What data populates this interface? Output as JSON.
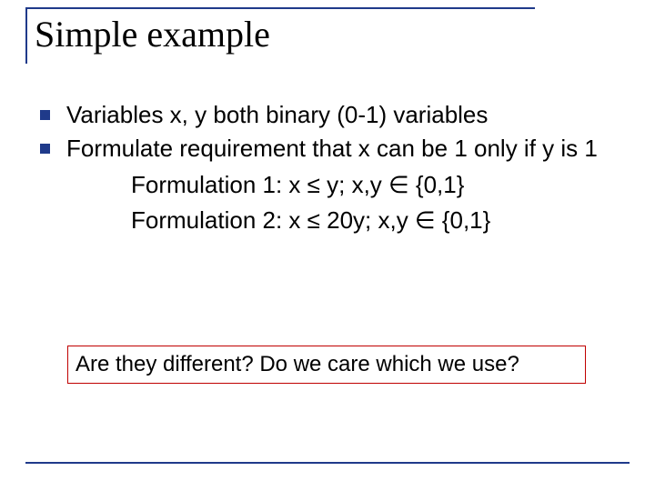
{
  "title": "Simple example",
  "bullets": [
    {
      "text": "Variables x, y both binary (0-1) variables"
    },
    {
      "text": "Formulate requirement that x can be 1 only if y is 1"
    }
  ],
  "sub": [
    "Formulation 1:  x ≤ y; x,y ∈ {0,1}",
    "Formulation 2: x ≤ 20y; x,y ∈ {0,1}"
  ],
  "callout": "Are they different?  Do we care which we use?"
}
